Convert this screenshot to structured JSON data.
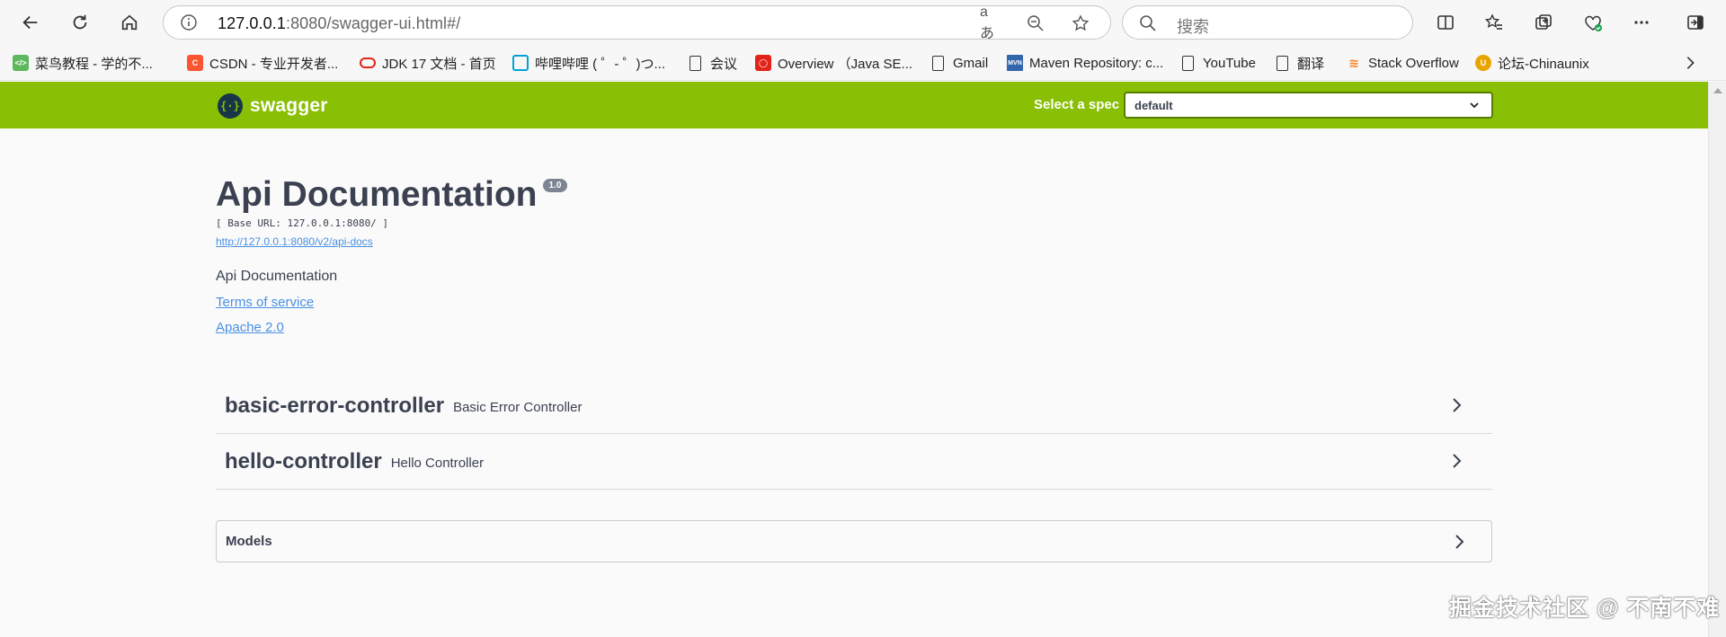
{
  "browser": {
    "url_host": "127.0.0.1",
    "url_rest": ":8080/swagger-ui.html#/",
    "search_placeholder": "搜索",
    "bookmarks": [
      {
        "label": "菜鸟教程 - 学的不...",
        "color": "#5eb85e"
      },
      {
        "label": "CSDN - 专业开发者...",
        "color": "#fc5531"
      },
      {
        "label": "JDK 17 文档 - 首页",
        "color": "#e2231a"
      },
      {
        "label": "哔哩哔哩 ( ゜- ゜)つ...",
        "color": "#00a1d6"
      },
      {
        "label": "会议",
        "color": ""
      },
      {
        "label": "Overview （Java SE...",
        "color": "#e2231a"
      },
      {
        "label": "Gmail",
        "color": ""
      },
      {
        "label": "Maven Repository: c...",
        "color": "#3366aa"
      },
      {
        "label": "YouTube",
        "color": ""
      },
      {
        "label": "翻译",
        "color": ""
      },
      {
        "label": "Stack Overflow",
        "color": "#f48024"
      },
      {
        "label": "论坛-Chinaunix",
        "color": "#e8a400"
      }
    ]
  },
  "swagger": {
    "logo_text": "swagger",
    "spec_label": "Select a spec",
    "spec_value": "default",
    "brand_color": "#89bf04",
    "info": {
      "title": "Api Documentation",
      "version": "1.0",
      "base_url": "[ Base URL: 127.0.0.1:8080/ ]",
      "api_docs_link": "http://127.0.0.1:8080/v2/api-docs",
      "description": "Api Documentation",
      "terms_of_service": "Terms of service",
      "license": "Apache 2.0"
    },
    "tags": [
      {
        "name": "basic-error-controller",
        "description": "Basic Error Controller"
      },
      {
        "name": "hello-controller",
        "description": "Hello Controller"
      }
    ],
    "models_label": "Models"
  },
  "watermark": "掘金技术社区 @ 不南不难"
}
